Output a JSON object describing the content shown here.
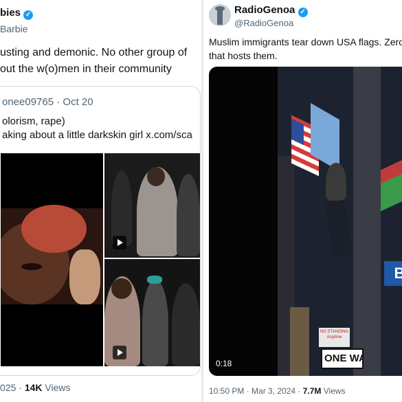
{
  "left": {
    "name": "bies",
    "handle": "Barbie",
    "body_line1": "usting and demonic. No other group of",
    "body_line2": "out the w(o)men in their community",
    "quote": {
      "handle": "onee09765 · Oct 20",
      "line1": "olorism, rape)",
      "line2": "aking about a little darkskin girl  x.com/sca"
    },
    "meta": {
      "date": "025 · ",
      "views_count": "14K",
      "views_label": " Views"
    }
  },
  "right": {
    "name": "RadioGenoa",
    "handle": "@RadioGenoa",
    "body_line1": "Muslim immigrants tear down USA flags. Zero",
    "body_line2": "that hosts them.",
    "video": {
      "duration": "0:18",
      "sign_top": "NO STANDING Anytime",
      "sign_one_way": "ONE WAY",
      "sign_letter": "B"
    },
    "meta": {
      "date": "10:50 PM · Mar 3, 2024 · ",
      "views_count": "7.7M",
      "views_label": " Views"
    }
  },
  "colors": {
    "verified": "#1d9bf0",
    "text": "#0f1419",
    "secondary": "#536471",
    "border": "#cfd9de"
  }
}
